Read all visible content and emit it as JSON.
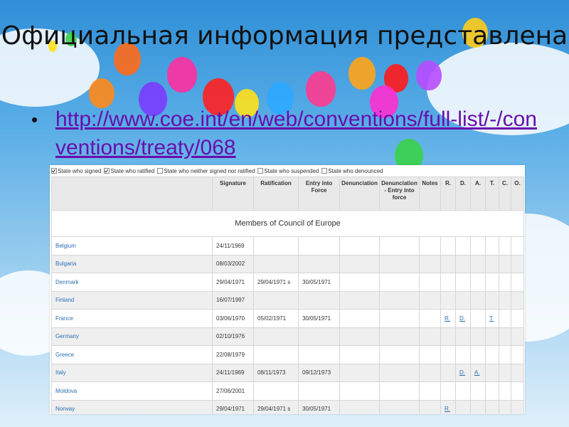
{
  "slide": {
    "title": "Официальная информация представлена",
    "bullet_link": "http://www.coe.int/en/web/conventions/full-list/-/conventions/treaty/068"
  },
  "legend": [
    {
      "label": "State who signed",
      "checked": true
    },
    {
      "label": "State who ratified",
      "checked": true
    },
    {
      "label": "State who neither signed nor ratified",
      "checked": false
    },
    {
      "label": "State who suspended",
      "checked": false
    },
    {
      "label": "State who denounced",
      "checked": false
    }
  ],
  "table": {
    "headers": [
      "",
      "Signature",
      "Ratification",
      "Entry into Force",
      "Denunciation",
      "Denunciation - Entry into force",
      "Notes",
      "R.",
      "D.",
      "A.",
      "T.",
      "C.",
      "O."
    ],
    "group_label": "Members of Council of Europe",
    "rows": [
      {
        "state": "Belgium",
        "signature": "24/11/1969",
        "ratification": "",
        "entry": "",
        "r": "",
        "d": "",
        "a": "",
        "t": ""
      },
      {
        "state": "Bulgaria",
        "signature": "08/03/2002",
        "ratification": "",
        "entry": "",
        "r": "",
        "d": "",
        "a": "",
        "t": ""
      },
      {
        "state": "Denmark",
        "signature": "29/04/1971",
        "ratification": "29/04/1971 s",
        "entry": "30/05/1971",
        "r": "",
        "d": "",
        "a": "",
        "t": ""
      },
      {
        "state": "Finland",
        "signature": "16/07/1997",
        "ratification": "",
        "entry": "",
        "r": "",
        "d": "",
        "a": "",
        "t": ""
      },
      {
        "state": "France",
        "signature": "03/06/1970",
        "ratification": "05/02/1971",
        "entry": "30/05/1971",
        "r": "R.",
        "d": "D.",
        "a": "",
        "t": "T."
      },
      {
        "state": "Germany",
        "signature": "02/10/1976",
        "ratification": "",
        "entry": "",
        "r": "",
        "d": "",
        "a": "",
        "t": ""
      },
      {
        "state": "Greece",
        "signature": "22/08/1979",
        "ratification": "",
        "entry": "",
        "r": "",
        "d": "",
        "a": "",
        "t": ""
      },
      {
        "state": "Italy",
        "signature": "24/11/1969",
        "ratification": "08/11/1973",
        "entry": "09/12/1973",
        "r": "",
        "d": "D.",
        "a": "A.",
        "t": ""
      },
      {
        "state": "Moldova",
        "signature": "27/06/2001",
        "ratification": "",
        "entry": "",
        "r": "",
        "d": "",
        "a": "",
        "t": ""
      },
      {
        "state": "Norway",
        "signature": "29/04/1971",
        "ratification": "29/04/1971 s",
        "entry": "30/05/1971",
        "r": "R.",
        "d": "",
        "a": "",
        "t": ""
      }
    ]
  },
  "colors": {
    "link": "#6a0dad",
    "table_link": "#2a6fb3",
    "header_bg": "#e9e9e9"
  }
}
